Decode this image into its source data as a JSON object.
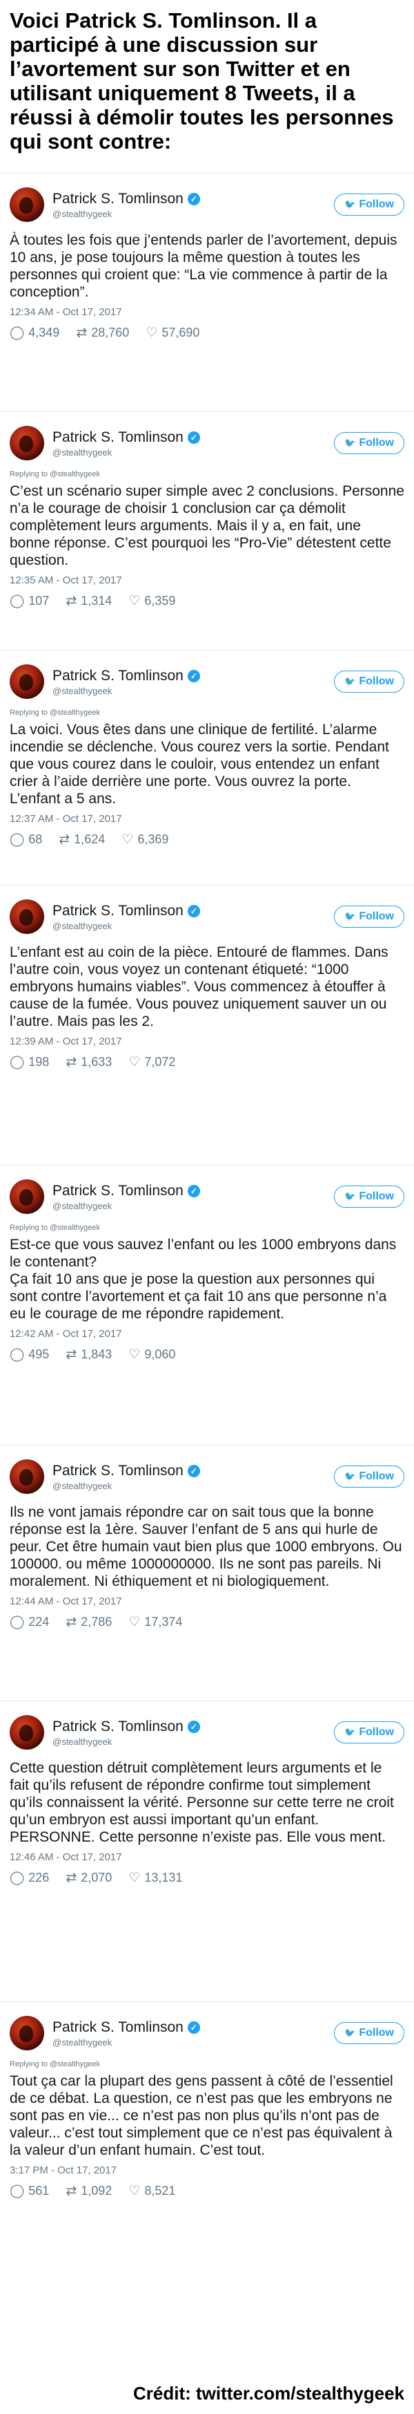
{
  "headline": "Voici Patrick S. Tomlinson. Il a participé à une discussion sur l’avortement sur son Twitter et en utilisant uniquement 8 Tweets, il a réussi à démolir toutes les personnes qui sont contre:",
  "follow_label": "Follow",
  "credit": "Crédit: twitter.com/stealthygeek",
  "tweets": [
    {
      "name": "Patrick S. Tomlinson",
      "handle": "@stealthygeek",
      "replying": "",
      "text": "À toutes les fois que j’entends parler de l’avortement, depuis 10 ans, je pose toujours la même question à toutes les personnes qui croient que: “La vie commence à partir de la conception”.",
      "time": "12:34 AM - Oct 17, 2017",
      "replies": "4,349",
      "retweets": "28,760",
      "likes": "57,690"
    },
    {
      "name": "Patrick S. Tomlinson",
      "handle": "@stealthygeek",
      "replying": "Replying to @stealthygeek",
      "text": "C’est un scénario super simple avec 2 conclusions. Personne n’a le courage de choisir 1 conclusion car ça démolit complètement leurs arguments. Mais il y a, en fait, une bonne réponse. C’est pourquoi les “Pro-Vie” détestent cette question.",
      "time": "12:35 AM - Oct 17, 2017",
      "replies": "107",
      "retweets": "1,314",
      "likes": "6,359"
    },
    {
      "name": "Patrick S. Tomlinson",
      "handle": "@stealthygeek",
      "replying": "Replying to @stealthygeek",
      "text": "La voici. Vous êtes dans une clinique de fertilité. L’alarme incendie se déclenche. Vous courez vers la sortie. Pendant que vous courez dans le couloir, vous entendez un enfant crier à l’aide derrière une porte. Vous ouvrez la porte. L’enfant a 5 ans.",
      "time": "12:37 AM - Oct 17, 2017",
      "replies": "68",
      "retweets": "1,624",
      "likes": "6,369"
    },
    {
      "name": "Patrick S. Tomlinson",
      "handle": "@stealthygeek",
      "replying": "",
      "text": "L’enfant est au coin de la pièce. Entouré de flammes. Dans l’autre coin, vous voyez un contenant étiqueté: “1000 embryons humains viables”. Vous commencez à étouffer à cause de la fumée. Vous pouvez uniquement sauver un ou l’autre. Mais pas les 2.",
      "time": "12:39 AM - Oct 17, 2017",
      "replies": "198",
      "retweets": "1,633",
      "likes": "7,072"
    },
    {
      "name": "Patrick S. Tomlinson",
      "handle": "@stealthygeek",
      "replying": "Replying to @stealthygeek",
      "text": "Est-ce que vous sauvez l’enfant ou les 1000 embryons dans le contenant?\nÇa fait 10 ans que je pose la question aux personnes qui sont contre l’avortement et ça fait 10 ans que personne n’a eu le courage de me répondre rapidement.",
      "time": "12:42 AM - Oct 17, 2017",
      "replies": "495",
      "retweets": "1,843",
      "likes": "9,060"
    },
    {
      "name": "Patrick S. Tomlinson",
      "handle": "@stealthygeek",
      "replying": "",
      "text": "Ils ne vont jamais répondre car on sait tous que la bonne réponse est la 1ère. Sauver l’enfant de 5 ans qui hurle de peur. Cet être humain vaut bien plus que 1000 embryons. Ou 100000. ou même 1000000000. Ils ne sont pas pareils. Ni moralement. Ni éthiquement et ni biologiquement.",
      "time": "12:44 AM - Oct 17, 2017",
      "replies": "224",
      "retweets": "2,786",
      "likes": "17,374"
    },
    {
      "name": "Patrick S. Tomlinson",
      "handle": "@stealthygeek",
      "replying": "",
      "text": "Cette question détruit complètement leurs arguments et le fait qu’ils refusent de répondre confirme tout simplement qu’ils connaissent la vérité. Personne sur cette terre ne croit qu’un embryon est aussi important qu’un enfant. PERSONNE. Cette personne n’existe pas. Elle vous ment.",
      "time": "12:46 AM - Oct 17, 2017",
      "replies": "226",
      "retweets": "2,070",
      "likes": "13,131"
    },
    {
      "name": "Patrick S. Tomlinson",
      "handle": "@stealthygeek",
      "replying": "Replying to @stealthygeek",
      "text": "Tout ça car la plupart des gens passent à côté de l’essentiel de ce débat. La question, ce n’est pas que les embryons ne sont pas en vie... ce n’est pas non plus qu’ils n’ont pas de valeur... c’est tout simplement que ce n’est pas équivalent à la valeur d’un enfant humain. C’est tout.",
      "time": "3:17 PM - Oct 17, 2017",
      "replies": "561",
      "retweets": "1,092",
      "likes": "8,521"
    }
  ]
}
